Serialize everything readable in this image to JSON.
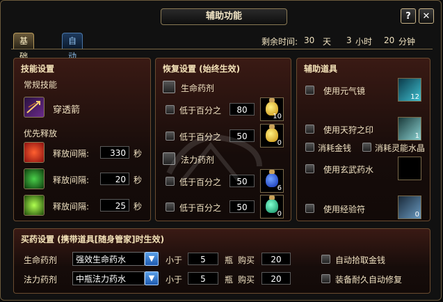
{
  "window": {
    "title": "辅助功能",
    "help_label": "?",
    "close_label": "✕"
  },
  "tabs": [
    {
      "label": "基础设置",
      "active": true
    },
    {
      "label": "自动战斗",
      "active": false
    }
  ],
  "timer": {
    "label": "剩余时间:",
    "days": "30",
    "days_unit": "天",
    "hours": "3",
    "hours_unit": "小时",
    "minutes": "20",
    "minutes_unit": "分钟"
  },
  "skills": {
    "title": "技能设置",
    "normal_label": "常规技能",
    "normal_skill": "穿透箭",
    "priority_label": "优先释放",
    "interval_label": "释放间隔:",
    "unit": "秒",
    "rows": [
      {
        "value": "330"
      },
      {
        "value": "20"
      },
      {
        "value": "25"
      }
    ]
  },
  "recovery": {
    "title": "恢复设置 (始终生效)",
    "hp_label": "生命药剂",
    "mp_label": "法力药剂",
    "below_label": "低于百分之",
    "hp_rows": [
      {
        "value": "80",
        "count": "10"
      },
      {
        "value": "50",
        "count": "0"
      }
    ],
    "mp_rows": [
      {
        "value": "50",
        "count": "6"
      },
      {
        "value": "50",
        "count": "0"
      }
    ]
  },
  "items": {
    "title": "辅助道具",
    "yuanqi_label": "使用元气镜",
    "yuanqi_count": "12",
    "tianshou_label": "使用天狩之印",
    "tianshou_count": "1",
    "gold_label": "消耗金钱",
    "crystal_label": "消耗灵能水晶",
    "xuanwu_label": "使用玄武药水",
    "exp_label": "使用经验符",
    "exp_count": "0"
  },
  "buy": {
    "title": "买药设置 (携带道具[随身管家]时生效)",
    "rows": [
      {
        "label": "生命药剂",
        "potion": "强效生命药水",
        "less_label": "小于",
        "less_value": "5",
        "bottle_label": "瓶",
        "buy_label": "购买",
        "buy_value": "20"
      },
      {
        "label": "法力药剂",
        "potion": "中瓶法力药水",
        "less_label": "小于",
        "less_value": "5",
        "bottle_label": "瓶",
        "buy_label": "购买",
        "buy_value": "20"
      }
    ],
    "auto_gold_label": "自动拾取金钱",
    "auto_repair_label": "装备耐久自动修复"
  },
  "icons": {
    "skill_main": "arrow-skill-icon",
    "skill_1": "red-fire-skill-icon",
    "skill_2": "green-poison-skill-icon",
    "skill_3": "green-burst-skill-icon",
    "hp_potion": "yellow-potion-icon",
    "mp_potion_1": "blue-potion-icon",
    "mp_potion_2": "teal-potion-icon",
    "yuanqi": "cyan-crystal-icon",
    "tianshou": "seal-icon",
    "exp": "scroll-icon"
  },
  "colors": {
    "accent": "#f3e2b8",
    "panel": "#3a1a14",
    "drop": "#3a7fd0"
  }
}
